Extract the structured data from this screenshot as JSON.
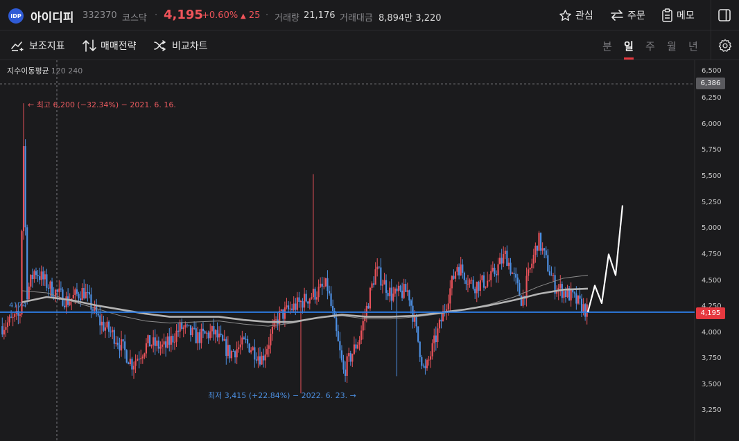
{
  "header": {
    "logo_text": "IDP",
    "name": "아이디피",
    "code": "332370",
    "market": "코스닥",
    "separator": "·",
    "price": "4,195",
    "change_pct": "+0.60%",
    "change_arrow": "▲",
    "change_value": "25",
    "volume_label": "거래량",
    "volume_value": "21,176",
    "amount_label": "거래대금",
    "amount_value": "8,894만 3,220",
    "watch_label": "관심",
    "order_label": "주문",
    "memo_label": "메모"
  },
  "toolbar": {
    "indicator_label": "보조지표",
    "strategy_label": "매매전략",
    "compare_label": "비교차트",
    "periods": [
      "분",
      "일",
      "주",
      "월",
      "년"
    ],
    "active_period": "일"
  },
  "chart": {
    "ma_legend_title": "지수이동평균",
    "ma_legend_values": "120 240",
    "high_annotation": "← 최고 6,200 (−32.34%) − 2021. 6. 16.",
    "low_annotation": "최저 3,415 (+22.84%) − 2022. 6. 23. →",
    "level_label": "4174",
    "high_tag": "6,386",
    "current_tag": "4,195",
    "y_axis": [
      "6,500",
      "6,250",
      "6,000",
      "5,750",
      "5,500",
      "5,250",
      "5,000",
      "4,750",
      "4,500",
      "4,250",
      "4,000",
      "3,750",
      "3,500",
      "3,250"
    ],
    "colors": {
      "up": "#e8525a",
      "down": "#4d8fe2",
      "level_line": "#2d7be0",
      "ma120": "#8c8c8c",
      "ma240": "#b4b4b4",
      "projection": "#ffffff",
      "current_tag": "#e6383f"
    }
  },
  "chart_data": {
    "type": "candlestick",
    "ylim": [
      3150,
      6570
    ],
    "y_ticks": [
      6500,
      6250,
      6000,
      5750,
      5500,
      5250,
      5000,
      4750,
      4500,
      4250,
      4000,
      3750,
      3500,
      3250
    ],
    "grid": false,
    "series": [
      {
        "name": "지수이동평균 120",
        "kind": "ema",
        "values": [
          4400,
          4380,
          4300,
          4230,
          4160,
          4110,
          4090,
          4100,
          4110,
          4080,
          4060,
          4090,
          4140,
          4160,
          4130,
          4130,
          4150,
          4180,
          4220,
          4270,
          4340,
          4440,
          4520,
          4550
        ]
      },
      {
        "name": "지수이동평균 240",
        "kind": "ema",
        "values": [
          4290,
          4340,
          4310,
          4260,
          4220,
          4180,
          4150,
          4150,
          4150,
          4120,
          4100,
          4100,
          4140,
          4170,
          4150,
          4150,
          4160,
          4190,
          4220,
          4260,
          4310,
          4370,
          4410,
          4420
        ]
      },
      {
        "name": "close",
        "kind": "price",
        "values": [
          4060,
          4150,
          4600,
          4420,
          4300,
          4400,
          4100,
          3950,
          3700,
          3900,
          3850,
          4050,
          3950,
          4000,
          3800,
          3900,
          3750,
          4150,
          4250,
          4350,
          4450,
          3620,
          3950,
          4600,
          4350,
          4400,
          3600,
          4100,
          4650,
          4450,
          4500,
          4750,
          4300,
          4900,
          4450,
          4350,
          4200
        ]
      },
      {
        "name": "projection",
        "kind": "path",
        "values": [
          4195,
          4450,
          4280,
          4750,
          4550,
          5220
        ]
      }
    ],
    "annotations": {
      "high": 6200,
      "low": 3415,
      "level": 4174,
      "current": 4195,
      "high_tag": 6386
    }
  }
}
